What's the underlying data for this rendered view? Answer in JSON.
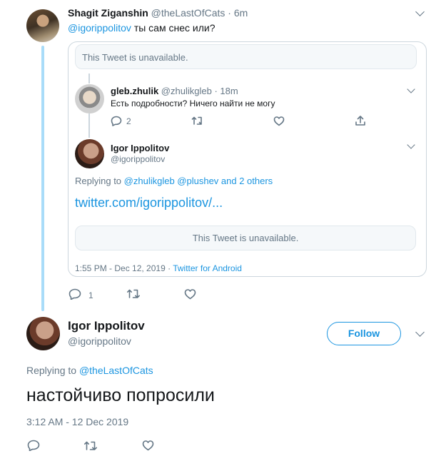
{
  "main_tweet": {
    "author_name": "Shagit Ziganshin",
    "author_handle": "@theLastOfCats",
    "separator": "·",
    "time": "6m",
    "mention": "@igorippolitov",
    "text": "ты сам снес или?",
    "reply_count": "1"
  },
  "quoted": {
    "unavailable_text": "This Tweet is unavailable.",
    "reply": {
      "author_name": "gleb.zhulik",
      "author_handle": "@zhulikgleb",
      "separator": "·",
      "time": "18m",
      "text": "Есть подробности? Ничего найти не могу",
      "reply_count": "2"
    },
    "tweet": {
      "author_name": "Igor Ippolitov",
      "author_handle": "@igorippolitov",
      "replying_to_label": "Replying to",
      "replying_to": "@zhulikgleb @plushev and 2 others",
      "link": "twitter.com/igorippolitov/...",
      "unavailable_text": "This Tweet is unavailable.",
      "timestamp": "1:55 PM - Dec 12, 2019",
      "separator": "·",
      "source": "Twitter for Android"
    }
  },
  "focal_tweet": {
    "author_name": "Igor Ippolitov",
    "author_handle": "@igorippolitov",
    "follow_label": "Follow",
    "replying_to_label": "Replying to",
    "replying_to": "@theLastOfCats",
    "text": "настойчиво попросили",
    "timestamp": "3:12 AM - 12 Dec 2019"
  },
  "colors": {
    "accent": "#1b95e0",
    "thread_line": "#a9dcf9",
    "muted": "#657786",
    "border": "#ccd6dd"
  },
  "icons": [
    "reply-icon",
    "retweet-icon",
    "like-icon",
    "share-icon",
    "chevron-down-icon"
  ]
}
